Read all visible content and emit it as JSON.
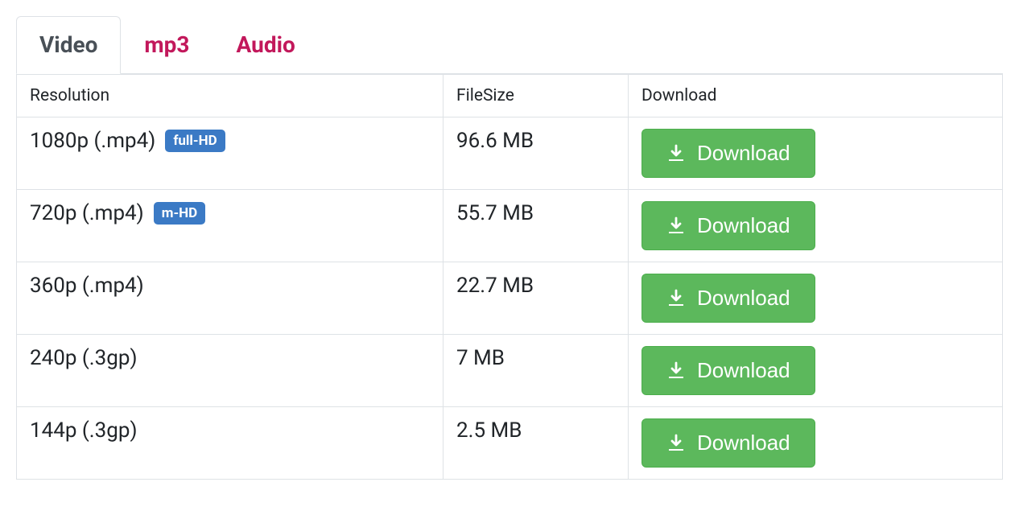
{
  "tabs": [
    {
      "label": "Video",
      "active": true
    },
    {
      "label": "mp3",
      "active": false
    },
    {
      "label": "Audio",
      "active": false
    }
  ],
  "headers": {
    "resolution": "Resolution",
    "filesize": "FileSize",
    "download": "Download"
  },
  "rows": [
    {
      "resolution": "1080p (.mp4)",
      "badge": "full-HD",
      "filesize": "96.6 MB",
      "button": "Download"
    },
    {
      "resolution": "720p (.mp4)",
      "badge": "m-HD",
      "filesize": "55.7 MB",
      "button": "Download"
    },
    {
      "resolution": "360p (.mp4)",
      "badge": "",
      "filesize": "22.7 MB",
      "button": "Download"
    },
    {
      "resolution": "240p (.3gp)",
      "badge": "",
      "filesize": "7 MB",
      "button": "Download"
    },
    {
      "resolution": "144p (.3gp)",
      "badge": "",
      "filesize": "2.5 MB",
      "button": "Download"
    }
  ]
}
